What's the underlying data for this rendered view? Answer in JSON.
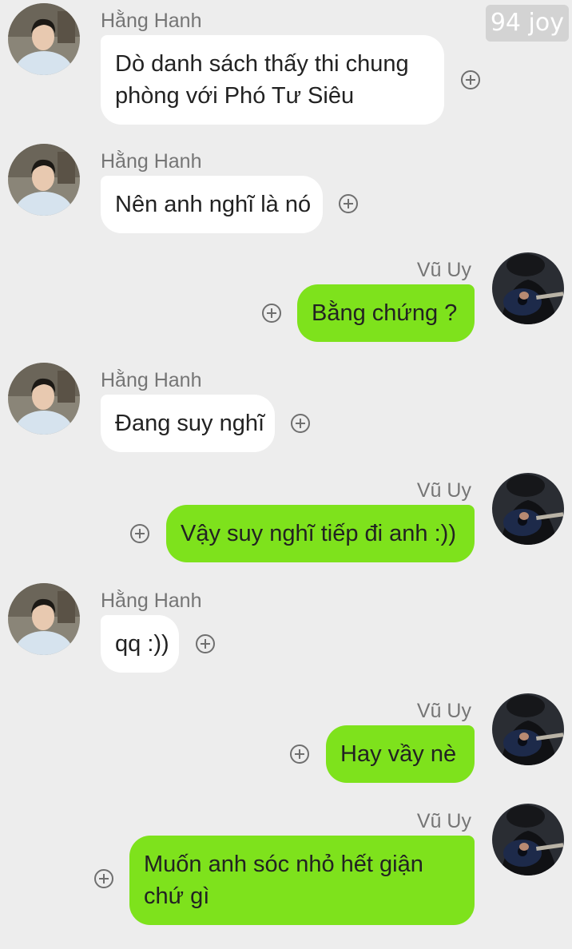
{
  "watermark": "94 joy",
  "messages": [
    {
      "sender": "Hằng Hanh",
      "text": "Dò danh sách thấy thi chung phòng với Phó Tư Siêu",
      "side": "in"
    },
    {
      "sender": "Hằng Hanh",
      "text": "Nên anh nghĩ là nó",
      "side": "in"
    },
    {
      "sender": "Vũ Uy",
      "text": "Bằng chứng ?",
      "side": "out"
    },
    {
      "sender": "Hằng Hanh",
      "text": "Đang suy nghĩ",
      "side": "in"
    },
    {
      "sender": "Vũ Uy",
      "text": "Vậy suy nghĩ tiếp đi anh :))",
      "side": "out"
    },
    {
      "sender": "Hằng Hanh",
      "text": "qq :))",
      "side": "in"
    },
    {
      "sender": "Vũ Uy",
      "text": "Hay vầy nè",
      "side": "out"
    },
    {
      "sender": "Vũ Uy",
      "text": "Muốn anh sóc nhỏ hết giận chứ gì",
      "side": "out"
    }
  ],
  "colors": {
    "background": "#ededed",
    "incoming_bubble": "#ffffff",
    "outgoing_bubble": "#7ee21c",
    "sender_name": "#757575"
  },
  "icons": {
    "add": "add-reaction-icon",
    "avatar_in": "avatar-hang-hanh",
    "avatar_out": "avatar-vu-uy"
  }
}
